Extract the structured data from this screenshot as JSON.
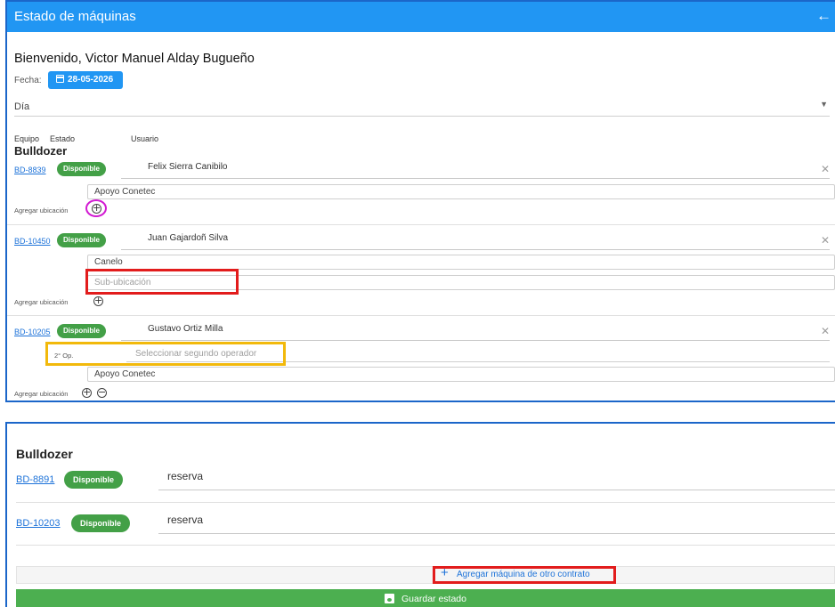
{
  "header": {
    "title": "Estado de máquinas",
    "back_icon": "←"
  },
  "welcome": "Bienvenido, Victor Manuel Alday Bugueño",
  "fecha": {
    "label": "Fecha:",
    "value": "28-05-2026"
  },
  "turno": {
    "value": "Día"
  },
  "columns": {
    "equipo": "Equipo",
    "estado": "Estado",
    "usuario": "Usuario"
  },
  "group1": {
    "title": "Bulldozer",
    "items": [
      {
        "code": "BD-8839",
        "status": "Disponible",
        "user": "Felix Sierra Canibilo",
        "ubicacion": "Apoyo Conetec",
        "agregar_label": "Agregar ubicación"
      },
      {
        "code": "BD-10450",
        "status": "Disponible",
        "user": "Juan Gajardoñ Silva",
        "ubicacion": "Canelo",
        "sububicacion_placeholder": "Sub-ubicación",
        "agregar_label": "Agregar ubicación"
      },
      {
        "code": "BD-10205",
        "status": "Disponible",
        "user": "Gustavo Ortiz Milla",
        "op2_label": "2° Op.",
        "op2_placeholder": "Seleccionar segundo operador",
        "ubicacion": "Apoyo Conetec",
        "agregar_label": "Agregar ubicación"
      }
    ]
  },
  "panel2": {
    "title": "Bulldozer",
    "items": [
      {
        "code": "BD-8891",
        "status": "Disponible",
        "user": "reserva"
      },
      {
        "code": "BD-10203",
        "status": "Disponible",
        "user": "reserva"
      }
    ],
    "add_button": "Agregar máquina de otro contrato",
    "save_button": "Guardar estado"
  },
  "colors": {
    "primary": "#2196f3",
    "success": "#43a047",
    "highlight_red": "#e21c1c",
    "highlight_yellow": "#f2b90b",
    "highlight_magenta": "#d21bd2"
  }
}
